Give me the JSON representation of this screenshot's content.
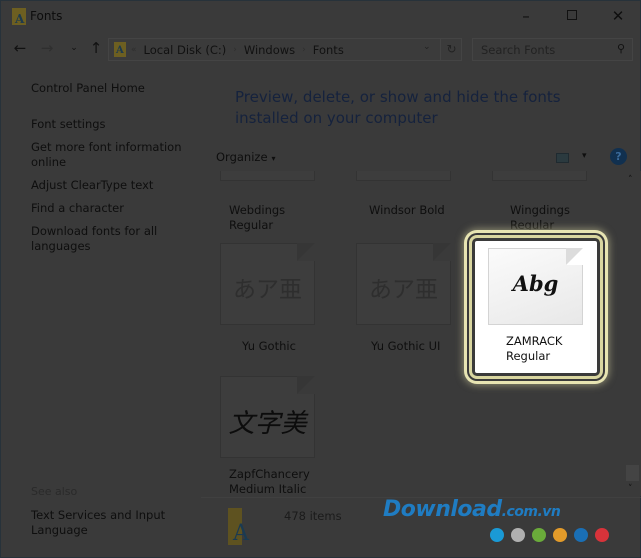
{
  "window": {
    "title": "Fonts",
    "controls": {
      "minimize": "–",
      "close": "✕"
    }
  },
  "nav": {
    "back": "←",
    "forward": "→",
    "recent": "⌄",
    "up": "↑",
    "address": {
      "overflow": "«",
      "crumbs": [
        "Local Disk (C:)",
        "Windows",
        "Fonts"
      ],
      "separator": "›",
      "dropdown": "⌄",
      "refresh": "↻"
    },
    "search": {
      "placeholder": "Search Fonts",
      "icon": "⚲"
    }
  },
  "left_panel": {
    "home": "Control Panel Home",
    "links": [
      "Font settings",
      "Get more font information online",
      "Adjust ClearType text",
      "Find a character",
      "Download fonts for all languages"
    ],
    "see_also_label": "See also",
    "see_also": [
      "Text Services and Input Language"
    ]
  },
  "content": {
    "heading": "Preview, delete, or show and hide the fonts installed on your computer",
    "toolbar": {
      "organize": "Organize",
      "caret": "▾",
      "help": "?"
    },
    "fonts": [
      {
        "name": "Webdings Regular",
        "preview": ""
      },
      {
        "name": "Windsor Bold",
        "preview": ""
      },
      {
        "name": "Wingdings Regular",
        "preview": ""
      },
      {
        "name": "Yu Gothic",
        "preview": "あア亜"
      },
      {
        "name": "Yu Gothic UI",
        "preview": "あア亜"
      },
      {
        "name": "ZAMRACK Regular",
        "preview": "Abg",
        "selected": true
      },
      {
        "name": "ZapfChancery Medium Italic",
        "preview": "文字美"
      }
    ],
    "scroll": {
      "up": "˄",
      "down": "˅"
    },
    "status": {
      "icon_letter": "A",
      "count": "478 items"
    }
  },
  "watermark": {
    "main": "Download",
    "domain": ".com.vn",
    "dot_colors": [
      "#1a9ad6",
      "#b0b0b0",
      "#6aab3a",
      "#e39b2a",
      "#1a6fb5",
      "#d8333a"
    ]
  }
}
